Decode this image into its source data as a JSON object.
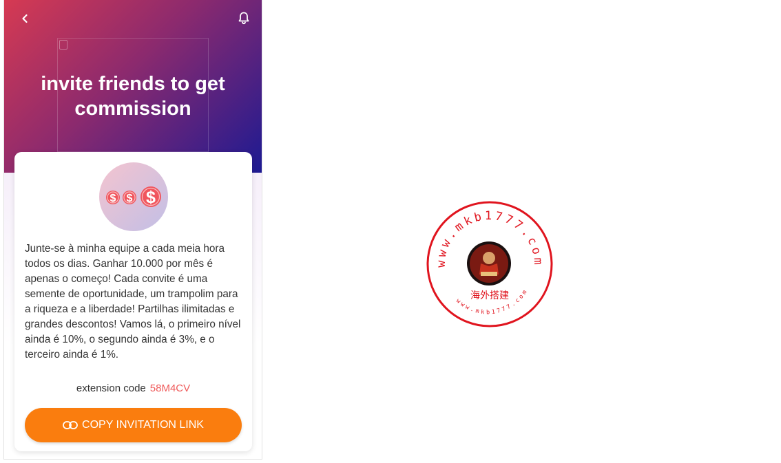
{
  "header": {
    "back_icon": "chevron-left-icon",
    "bell_icon": "bell-icon",
    "title": "invite friends to get commission"
  },
  "card": {
    "coin_icon": "dollar-coins-icon",
    "description": "Junte-se à minha equipe a cada meia hora todos os dias. Ganhar 10.000 por mês é apenas o começo! Cada convite é uma semente de oportunidade, um trampolim para a riqueza e a liberdade! Partilhas ilimitadas e grandes descontos! Vamos lá, o primeiro nível ainda é 10%, o segundo ainda é 3%, e o terceiro ainda é 1%.",
    "extension_label": "extension code",
    "extension_code": "58M4CV",
    "copy_button_label": "COPY INVITATION LINK",
    "copy_icon": "link-icon"
  },
  "watermark": {
    "url_top": "www.mkb1777.com",
    "url_bottom": "www.mkb1777.com",
    "chinese_text": "海外搭建"
  },
  "colors": {
    "gradient_start": "#d63a52",
    "gradient_end": "#1d1a92",
    "accent_orange": "#fa7d0e",
    "code_red": "#ef5a5a",
    "seal_red": "#e0141e"
  }
}
